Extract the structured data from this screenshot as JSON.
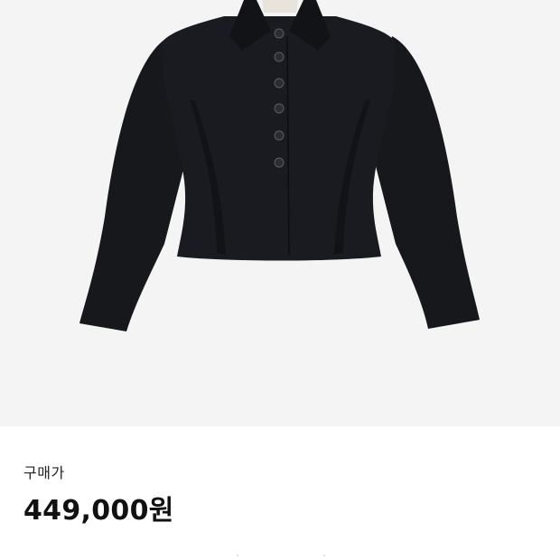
{
  "product": {
    "image_icon": "jacket-image",
    "image_background": "#f4f4f4",
    "jacket_color": "#16171b",
    "button_count": 6
  },
  "price": {
    "label": "구매가",
    "value": "449,000원"
  }
}
